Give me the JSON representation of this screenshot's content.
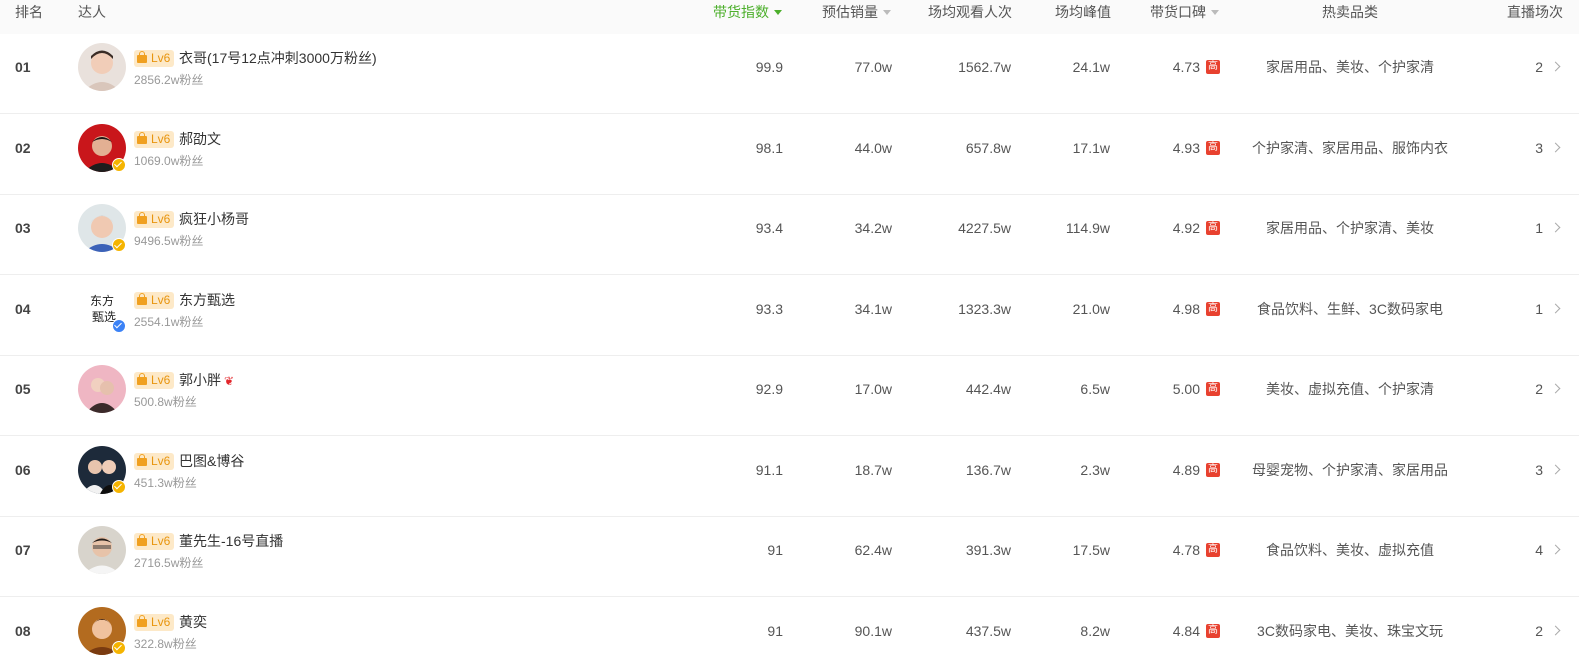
{
  "header": {
    "rank": "排名",
    "influencer": "达人",
    "sales_index": "带货指数",
    "est_sales": "预估销量",
    "avg_views": "场均观看人次",
    "avg_peak": "场均峰值",
    "reputation": "带货口碑",
    "hot_categories": "热卖品类",
    "sessions": "直播场次"
  },
  "badge": {
    "level": "Lv6",
    "high": "高"
  },
  "colors": {
    "active_sort": "#4caf2b",
    "level_bg": "#fde9c8",
    "level_fg": "#e8950e",
    "high_tag": "#e8412f",
    "verify_gold": "#f5b400",
    "verify_blue": "#3b82f6"
  },
  "rows": [
    {
      "rank": "01",
      "name": "衣哥(17号12点冲刺3000万粉丝)",
      "fans": "2856.2w粉丝",
      "index": "99.9",
      "sales": "77.0w",
      "views": "1562.7w",
      "peak": "24.1w",
      "rating": "4.73",
      "categories": "家居用品、美妆、个护家清",
      "sessions": "2",
      "verified": "none"
    },
    {
      "rank": "02",
      "name": "郝劭文",
      "fans": "1069.0w粉丝",
      "index": "98.1",
      "sales": "44.0w",
      "views": "657.8w",
      "peak": "17.1w",
      "rating": "4.93",
      "categories": "个护家清、家居用品、服饰内衣",
      "sessions": "3",
      "verified": "gold"
    },
    {
      "rank": "03",
      "name": "疯狂小杨哥",
      "fans": "9496.5w粉丝",
      "index": "93.4",
      "sales": "34.2w",
      "views": "4227.5w",
      "peak": "114.9w",
      "rating": "4.92",
      "categories": "家居用品、个护家清、美妆",
      "sessions": "1",
      "verified": "gold"
    },
    {
      "rank": "04",
      "name": "东方甄选",
      "fans": "2554.1w粉丝",
      "index": "93.3",
      "sales": "34.1w",
      "views": "1323.3w",
      "peak": "21.0w",
      "rating": "4.98",
      "categories": "食品饮料、生鲜、3C数码家电",
      "sessions": "1",
      "verified": "blue"
    },
    {
      "rank": "05",
      "name": "郭小胖",
      "fans": "500.8w粉丝",
      "index": "92.9",
      "sales": "17.0w",
      "views": "442.4w",
      "peak": "6.5w",
      "rating": "5.00",
      "categories": "美妆、虚拟充值、个护家清",
      "sessions": "2",
      "verified": "none"
    },
    {
      "rank": "06",
      "name": "巴图&博谷",
      "fans": "451.3w粉丝",
      "index": "91.1",
      "sales": "18.7w",
      "views": "136.7w",
      "peak": "2.3w",
      "rating": "4.89",
      "categories": "母婴宠物、个护家清、家居用品",
      "sessions": "3",
      "verified": "gold"
    },
    {
      "rank": "07",
      "name": "董先生-16号直播",
      "fans": "2716.5w粉丝",
      "index": "91",
      "sales": "62.4w",
      "views": "391.3w",
      "peak": "17.5w",
      "rating": "4.78",
      "categories": "食品饮料、美妆、虚拟充值",
      "sessions": "4",
      "verified": "none"
    },
    {
      "rank": "08",
      "name": "黄奕",
      "fans": "322.8w粉丝",
      "index": "91",
      "sales": "90.1w",
      "views": "437.5w",
      "peak": "8.2w",
      "rating": "4.84",
      "categories": "3C数码家电、美妆、珠宝文玩",
      "sessions": "2",
      "verified": "gold"
    }
  ]
}
